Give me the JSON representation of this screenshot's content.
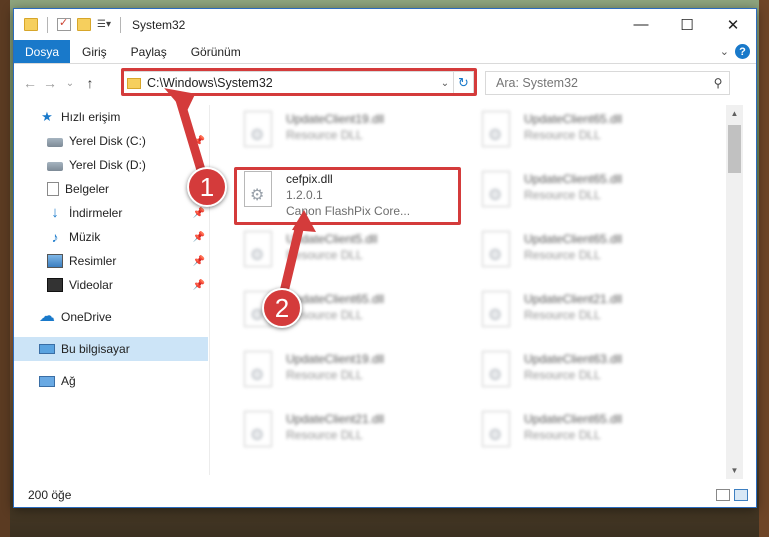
{
  "window": {
    "title": "System32"
  },
  "winbtns": {
    "minimize": "—",
    "maximize": "☐",
    "close": "✕"
  },
  "ribbon": {
    "file_tab": "Dosya",
    "tabs": [
      "Giriş",
      "Paylaş",
      "Görünüm"
    ]
  },
  "nav": {
    "back": "←",
    "forward": "→",
    "recent": "⌄",
    "up": "↑",
    "address": "C:\\Windows\\System32",
    "search_placeholder": "Ara: System32"
  },
  "sidebar": {
    "items": [
      {
        "label": "Hızlı erişim",
        "icon": "star-icon"
      },
      {
        "label": "Yerel Disk (C:)",
        "icon": "disk-icon"
      },
      {
        "label": "Yerel Disk (D:)",
        "icon": "disk-icon"
      },
      {
        "label": "Belgeler",
        "icon": "document-icon"
      },
      {
        "label": "İndirmeler",
        "icon": "download-icon"
      },
      {
        "label": "Müzik",
        "icon": "music-icon"
      },
      {
        "label": "Resimler",
        "icon": "pictures-icon"
      },
      {
        "label": "Videolar",
        "icon": "video-icon"
      },
      {
        "label": "OneDrive",
        "icon": "cloud-icon"
      },
      {
        "label": "Bu bilgisayar",
        "icon": "computer-icon"
      },
      {
        "label": "Ağ",
        "icon": "network-icon"
      }
    ]
  },
  "files": {
    "left": [
      {
        "name": "UpdateClient19.dll",
        "sub1": "Resource DLL",
        "sub2": ""
      },
      {
        "name": "cefpix.dll",
        "sub1": "1.2.0.1",
        "sub2": "Canon FlashPix Core..."
      },
      {
        "name": "UpdateClient5.dll",
        "sub1": "Resource DLL",
        "sub2": ""
      },
      {
        "name": "UpdateClient65.dll",
        "sub1": "Resource DLL",
        "sub2": ""
      },
      {
        "name": "UpdateClient19.dll",
        "sub1": "Resource DLL",
        "sub2": ""
      },
      {
        "name": "UpdateClient21.dll",
        "sub1": "Resource DLL",
        "sub2": ""
      }
    ],
    "right": [
      {
        "name": "UpdateClient65.dll",
        "sub1": "Resource DLL"
      },
      {
        "name": "UpdateClient65.dll",
        "sub1": "Resource DLL"
      },
      {
        "name": "UpdateClient65.dll",
        "sub1": "Resource DLL"
      },
      {
        "name": "UpdateClient21.dll",
        "sub1": "Resource DLL"
      },
      {
        "name": "UpdateClient63.dll",
        "sub1": "Resource DLL"
      },
      {
        "name": "UpdateClient65.dll",
        "sub1": "Resource DLL"
      }
    ]
  },
  "status": {
    "count": "200 öğe"
  },
  "callouts": {
    "one": "1",
    "two": "2"
  },
  "colors": {
    "accent": "#1979ca",
    "highlight": "#d43b3b",
    "selected": "#cce4f7"
  }
}
